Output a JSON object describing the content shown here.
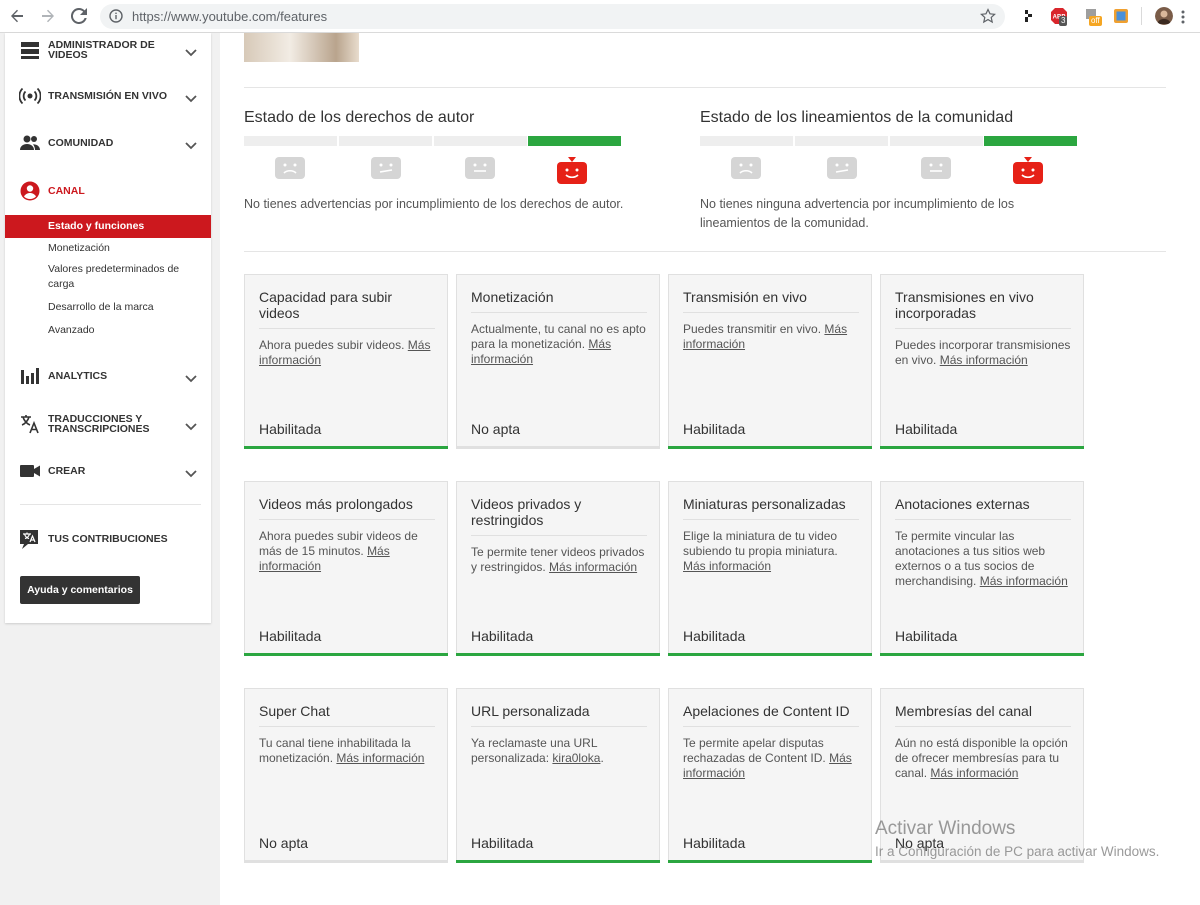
{
  "browser": {
    "url": "https://www.youtube.com/features",
    "ext_badge_abp": "3",
    "ext_badge_off": "off"
  },
  "sidebar": {
    "items": [
      {
        "label_1": "ADMINISTRADOR DE",
        "label_2": "VIDEOS",
        "icon": "video-manager-icon"
      },
      {
        "label_1": "TRANSMISIÓN EN VIVO",
        "icon": "live-icon"
      },
      {
        "label_1": "COMUNIDAD",
        "icon": "community-icon"
      },
      {
        "label_1": "CANAL",
        "icon": "channel-icon"
      },
      {
        "label_1": "ANALYTICS",
        "icon": "analytics-icon"
      },
      {
        "label_1": "TRADUCCIONES Y",
        "label_2": "TRANSCRIPCIONES",
        "icon": "translate-icon"
      },
      {
        "label_1": "CREAR",
        "icon": "create-icon"
      },
      {
        "label_1": "TUS CONTRIBUCIONES",
        "icon": "contributions-icon"
      }
    ],
    "sub_items": [
      "Estado y funciones",
      "Monetización",
      "Valores predeterminados de",
      "carga",
      "Desarrollo de la marca",
      "Avanzado"
    ],
    "help_button": "Ayuda y comentarios"
  },
  "status": {
    "copyright": {
      "title": "Estado de los derechos de autor",
      "text_1": "No tienes advertencias por incumplimiento de los derechos de autor.",
      "text_2": "",
      "level": 4,
      "levels": 4
    },
    "community": {
      "title": "Estado de los lineamientos de la comunidad",
      "text_1": "No tienes ninguna advertencia por incumplimiento de los",
      "text_2": "lineamientos de la comunidad.",
      "level": 4,
      "levels": 4
    }
  },
  "features": [
    {
      "title": "Capacidad para subir videos",
      "desc": "Ahora puedes subir videos.",
      "link": "Más información",
      "status": "Habilitada",
      "ok": true
    },
    {
      "title": "Monetización",
      "desc": "Actualmente, tu canal no es apto para la monetización.",
      "link": "Más información",
      "status": "No apta",
      "ok": false
    },
    {
      "title": "Transmisión en vivo",
      "desc": "Puedes transmitir en vivo.",
      "link": "Más información",
      "status": "Habilitada",
      "ok": true
    },
    {
      "title": "Transmisiones en vivo incorporadas",
      "desc": "Puedes incorporar transmisiones en vivo.",
      "link": "Más información",
      "status": "Habilitada",
      "ok": true
    },
    {
      "title": "Videos más prolongados",
      "desc": "Ahora puedes subir videos de más de 15 minutos.",
      "link": "Más información",
      "status": "Habilitada",
      "ok": true
    },
    {
      "title": "Videos privados y restringidos",
      "desc": "Te permite tener videos privados y restringidos.",
      "link": "Más información",
      "status": "Habilitada",
      "ok": true
    },
    {
      "title": "Miniaturas personalizadas",
      "desc": "Elige la miniatura de tu video subiendo tu propia miniatura.",
      "link": "Más información",
      "status": "Habilitada",
      "ok": true
    },
    {
      "title": "Anotaciones externas",
      "desc": "Te permite vincular las anotaciones a tus sitios web externos o a tus socios de merchandising.",
      "link": "Más información",
      "status": "Habilitada",
      "ok": true
    },
    {
      "title": "Super Chat",
      "desc": "Tu canal tiene inhabilitada la monetización.",
      "link": "Más información",
      "status": "No apta",
      "ok": false
    },
    {
      "title": "URL personalizada",
      "desc": "Ya reclamaste una URL personalizada:",
      "link": "kira0loka",
      "suffix": ".",
      "status": "Habilitada",
      "ok": true
    },
    {
      "title": "Apelaciones de Content ID",
      "desc": "Te permite apelar disputas rechazadas de Content ID.",
      "link": "Más información",
      "status": "Habilitada",
      "ok": true
    },
    {
      "title": "Membresías del canal",
      "desc": "Aún no está disponible la opción de ofrecer membresías para tu canal.",
      "link": "Más información",
      "status": "No apta",
      "ok": false
    }
  ],
  "watermark": {
    "line_1": "Activar Windows",
    "line_2": "Ir a Configuración de PC para activar Windows."
  }
}
